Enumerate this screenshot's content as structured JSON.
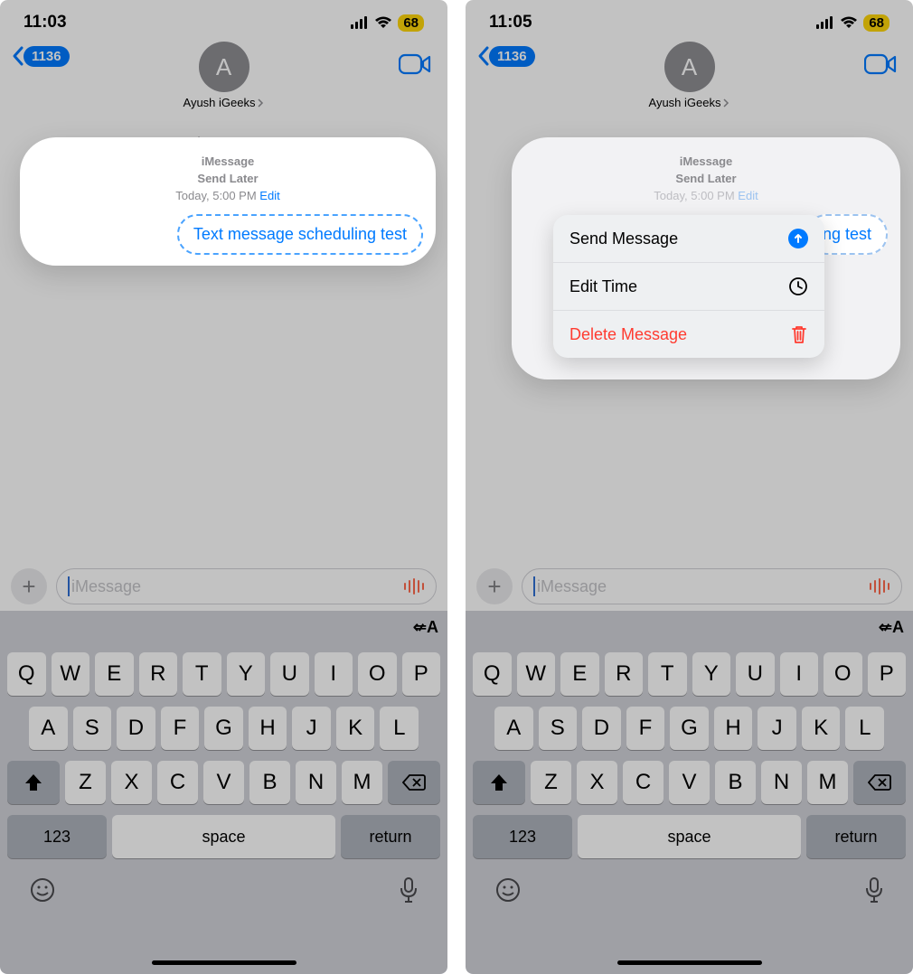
{
  "screens": [
    {
      "status": {
        "time": "11:03",
        "battery": "68"
      },
      "nav": {
        "back_count": "1136",
        "contact_name": "Ayush iGeeks",
        "avatar_initial": "A"
      },
      "message": {
        "service": "iMessage",
        "send_label": "Send Later",
        "schedule": "Today, 5:00 PM",
        "edit": "Edit",
        "bubble": "Text message scheduling test"
      },
      "input": {
        "placeholder": "iMessage"
      }
    },
    {
      "status": {
        "time": "11:05",
        "battery": "68"
      },
      "nav": {
        "back_count": "1136",
        "contact_name": "Ayush iGeeks",
        "avatar_initial": "A"
      },
      "message": {
        "service": "iMessage",
        "send_label": "Send Later",
        "schedule": "Today, 5:00 PM",
        "edit": "Edit",
        "bubble_tail": "ng test"
      },
      "input": {
        "placeholder": "iMessage"
      },
      "menu": {
        "send": "Send Message",
        "edit_time": "Edit Time",
        "delete": "Delete Message"
      }
    }
  ],
  "keyboard": {
    "row1": [
      "Q",
      "W",
      "E",
      "R",
      "T",
      "Y",
      "U",
      "I",
      "O",
      "P"
    ],
    "row2": [
      "A",
      "S",
      "D",
      "F",
      "G",
      "H",
      "J",
      "K",
      "L"
    ],
    "row3": [
      "Z",
      "X",
      "C",
      "V",
      "B",
      "N",
      "M"
    ],
    "num": "123",
    "space": "space",
    "return": "return"
  }
}
